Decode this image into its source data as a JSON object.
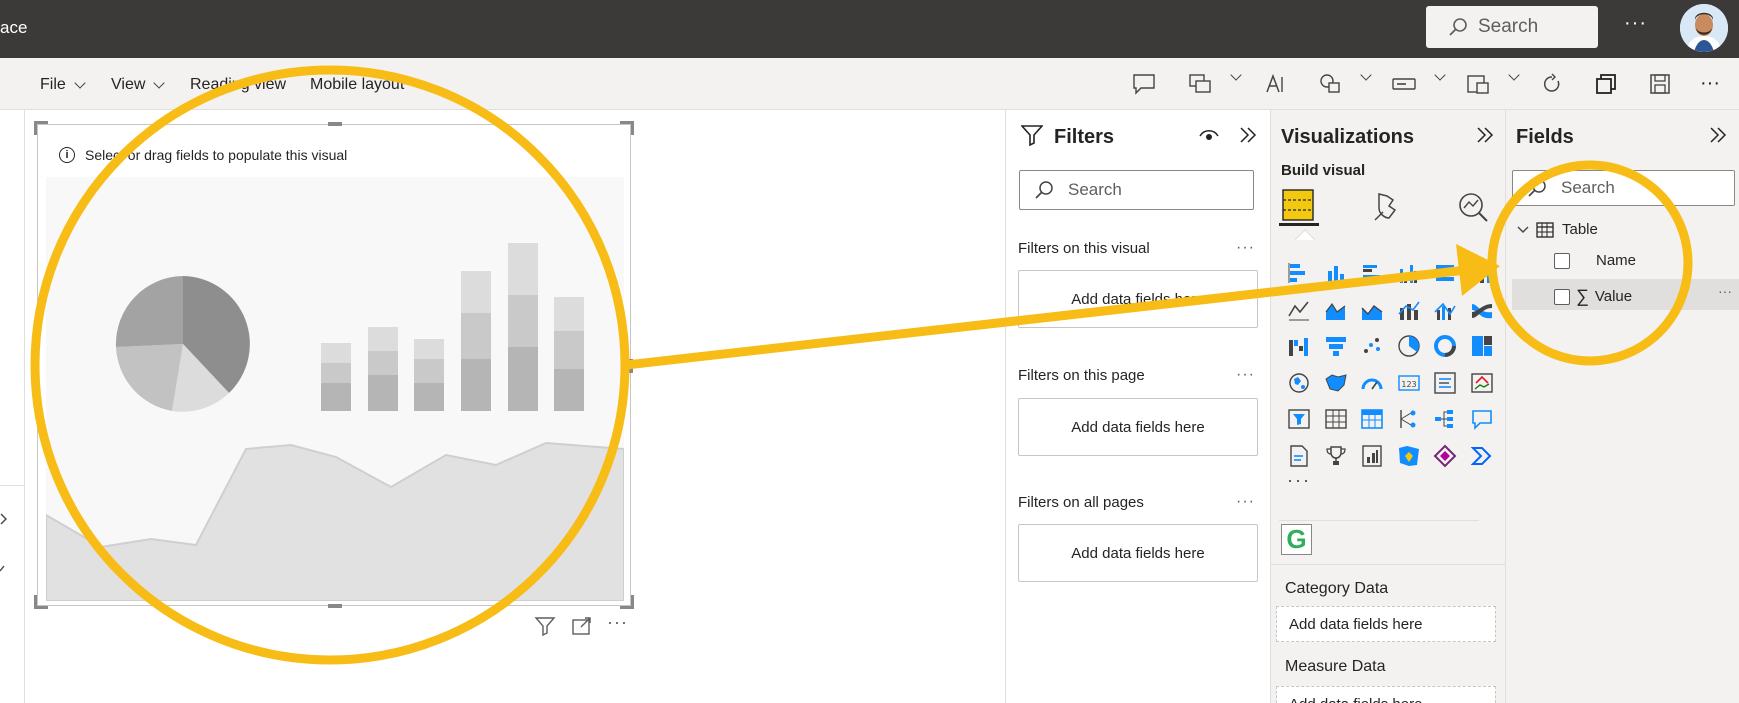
{
  "header": {
    "workspace_title": "ace",
    "search_placeholder": "Search",
    "more_label": "···"
  },
  "ribbon": {
    "file": "File",
    "view": "View",
    "reading_view": "Reading view",
    "mobile_layout": "Mobile layout",
    "more_label": "···"
  },
  "canvas": {
    "visual_hint": "Select or drag fields to populate this visual"
  },
  "filters": {
    "title": "Filters",
    "search_placeholder": "Search",
    "sections": [
      {
        "label": "Filters on this visual",
        "drop": "Add data fields here"
      },
      {
        "label": "Filters on this page",
        "drop": "Add data fields here"
      },
      {
        "label": "Filters on all pages",
        "drop": "Add data fields here"
      }
    ],
    "dots": "···"
  },
  "visualizations": {
    "title": "Visualizations",
    "build_label": "Build visual",
    "more_visuals": "···",
    "custom_visual_letter": "G",
    "wells": [
      {
        "label": "Category Data",
        "drop": "Add data fields here"
      },
      {
        "label": "Measure Data",
        "drop": "Add data fields here"
      }
    ]
  },
  "fields": {
    "title": "Fields",
    "search_placeholder": "Search",
    "table_name": "Table",
    "items": [
      {
        "label": "Name"
      },
      {
        "label": "Value",
        "sigma": "∑"
      }
    ],
    "dots": "···"
  },
  "colors": {
    "topbar": "#3b3a39",
    "pane_bg": "#f3f2f1",
    "highlight": "#f8bc16",
    "accent_yellow": "#f2c811"
  }
}
